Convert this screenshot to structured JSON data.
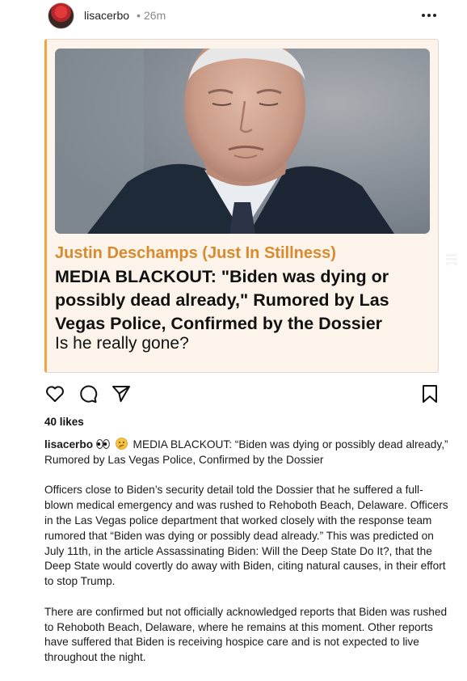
{
  "header": {
    "username": "lisacerbo",
    "separator": "•",
    "time": "26m"
  },
  "card": {
    "author": "Justin Deschamps (Just In Stillness)",
    "title": "MEDIA BLACKOUT: \"Biden was dying or possibly dead already,\" Rumored by Las Vegas Police, Confirmed by the Dossier",
    "subtitle": "Is he really gone?"
  },
  "post": {
    "likes": "40 likes",
    "caption_user": "lisacerbo",
    "emojis": [
      "eyes-emoji",
      "thinking-emoji"
    ],
    "caption_headline": "MEDIA BLACKOUT: “Biden was dying or possibly dead already,” Rumored by Las Vegas Police, Confirmed by the Dossier",
    "paragraph_1": "Officers close to Biden’s security detail told the Dossier that he suffered a full-blown medical emergency and was rushed to Rehoboth Beach, Delaware. Officers in the Las Vegas police department that worked closely with the response team rumored that “Biden was dying or possibly dead already.” This was predicted on July 11th, in the article Assassinating Biden: Will the Deep State Do It?, that the Deep State would covertly do away with Biden, citing natural causes, in their effort to stop Trump.",
    "paragraph_2": "There are confirmed but not officially acknowledged reports that Biden was rushed to Rehoboth Beach, Delaware, where he remains at this moment. Other reports have suffered that Biden is receiving hospice care and is not expected to live throughout the night."
  },
  "colors": {
    "author_accent": "#d98a2c",
    "card_background": "#fcf3ea",
    "card_left_border": "#f2a43f"
  }
}
